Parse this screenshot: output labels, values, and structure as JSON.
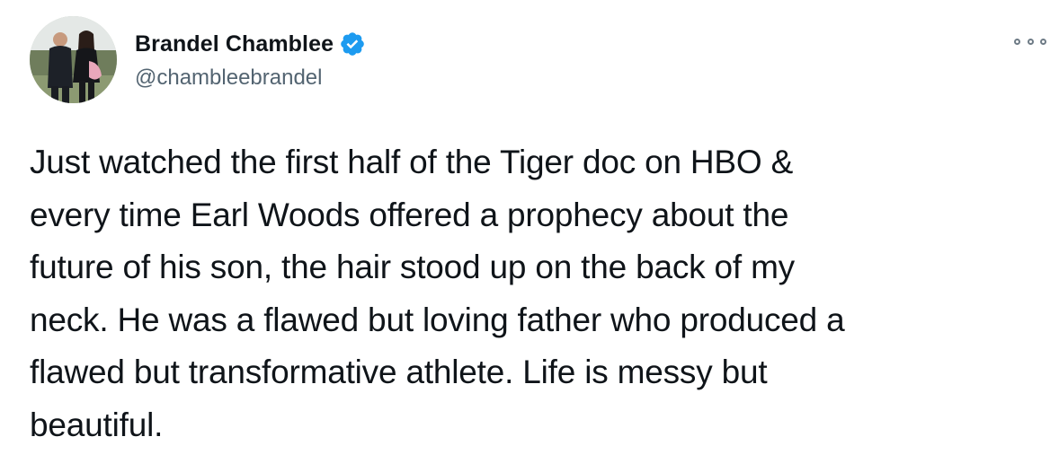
{
  "tweet": {
    "author": {
      "display_name": "Brandel Chamblee",
      "handle": "@chambleebrandel",
      "verified": true,
      "avatar_icon": "profile-photo"
    },
    "more_icon": "more-options-icon",
    "text_lines": [
      "Just watched the first half of the Tiger doc on HBO &",
      "every time Earl Woods offered a prophecy about the",
      "future of his son, the hair stood up on the back of my",
      "neck. He was a flawed but loving father who produced a",
      "flawed but transformative athlete. Life is messy but",
      "beautiful."
    ]
  },
  "colors": {
    "verified_blue": "#1d9bf0",
    "text": "#0f1419",
    "secondary_text": "#536471"
  }
}
